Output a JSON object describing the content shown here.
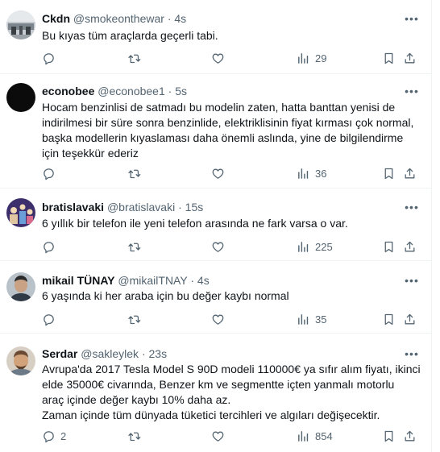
{
  "tweets": [
    {
      "name": "Ckdn",
      "handle": "@smokeonthewar",
      "time": "4s",
      "text": "Bu kıyas tüm araçlarda geçerli tabi.",
      "replies": "",
      "retweets": "",
      "likes": "",
      "views": "29"
    },
    {
      "name": "econobee",
      "handle": "@econobee1",
      "time": "5s",
      "text": "Hocam benzinlisi de satmadı bu modelin zaten, hatta banttan yenisi de\nindirilmesi bir süre sonra benzinlide, elektriklisinin fiyat kırması çok normal,\nbaşka modellerin kıyaslaması daha önemli aslında, yine de bilgilendirme\niçin teşekkür ederiz",
      "replies": "",
      "retweets": "",
      "likes": "",
      "views": "36"
    },
    {
      "name": "bratislavaki",
      "handle": "@bratislavaki",
      "time": "15s",
      "text": "6 yıllık bir telefon ile yeni telefon arasında ne fark varsa o var.",
      "replies": "",
      "retweets": "",
      "likes": "",
      "views": "225"
    },
    {
      "name": "mikail TÜNAY",
      "handle": "@mikailTNAY",
      "time": "4s",
      "text": "6 yaşında ki her araba için bu değer kaybı normal",
      "replies": "",
      "retweets": "",
      "likes": "",
      "views": "35"
    },
    {
      "name": "Serdar",
      "handle": "@sakleylek",
      "time": "23s",
      "text": "Avrupa'da 2017 Tesla Model S 90D modeli 110000€ ya sıfır alım fiyatı, ikinci\nelde 35000€ civarında, Benzer km ve segmentte içten yanmalı motorlu\naraç içinde değer kaybı 10% daha az.\nZaman içinde tüm dünyada tüketici tercihleri ve algıları değişecektir.",
      "replies": "2",
      "retweets": "",
      "likes": "",
      "views": "854"
    }
  ],
  "separator": "·",
  "more_glyph": "•••",
  "colors": {
    "text": "#0f1419",
    "secondary": "#536471",
    "divider": "#eff3f4"
  }
}
